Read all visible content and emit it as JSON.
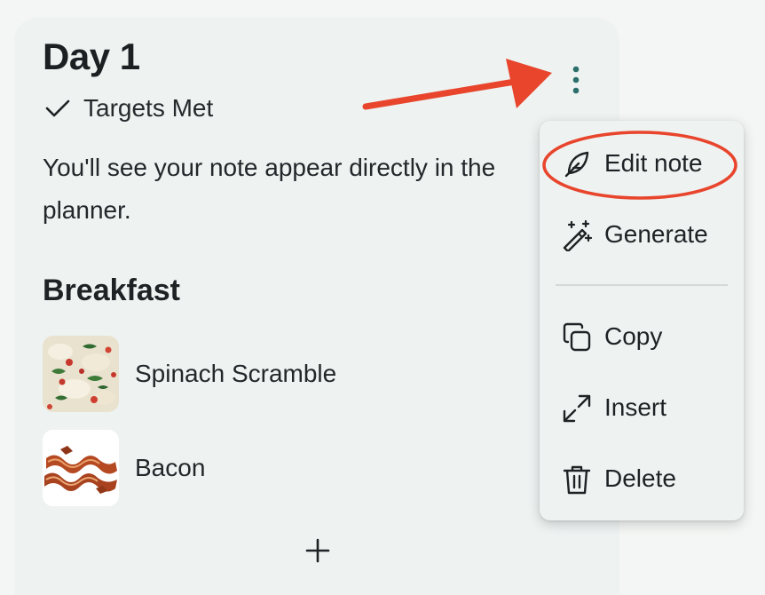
{
  "day_card": {
    "title": "Day 1",
    "targets_label": "Targets Met",
    "note_text": "You'll see your note appear directly in the planner.",
    "more_icon": "more-vertical-icon",
    "add_icon": "plus-icon",
    "section": {
      "heading": "Breakfast",
      "items": [
        {
          "name": "Spinach Scramble",
          "thumb": "spinach-scramble-photo"
        },
        {
          "name": "Bacon",
          "thumb": "bacon-photo"
        }
      ]
    }
  },
  "menu": {
    "items": [
      {
        "label": "Edit note",
        "icon": "feather-icon"
      },
      {
        "label": "Generate",
        "icon": "magic-wand-icon"
      },
      {
        "label": "Copy",
        "icon": "copy-icon"
      },
      {
        "label": "Insert",
        "icon": "expand-arrows-icon"
      },
      {
        "label": "Delete",
        "icon": "trash-icon"
      }
    ]
  },
  "annotations": {
    "arrow_color": "#e8452c",
    "highlight_color": "#e8452c",
    "highlighted_item": "Edit note"
  },
  "colors": {
    "background": "#f4f6f5",
    "card": "#eef2f1",
    "accent": "#2b6f6b"
  }
}
